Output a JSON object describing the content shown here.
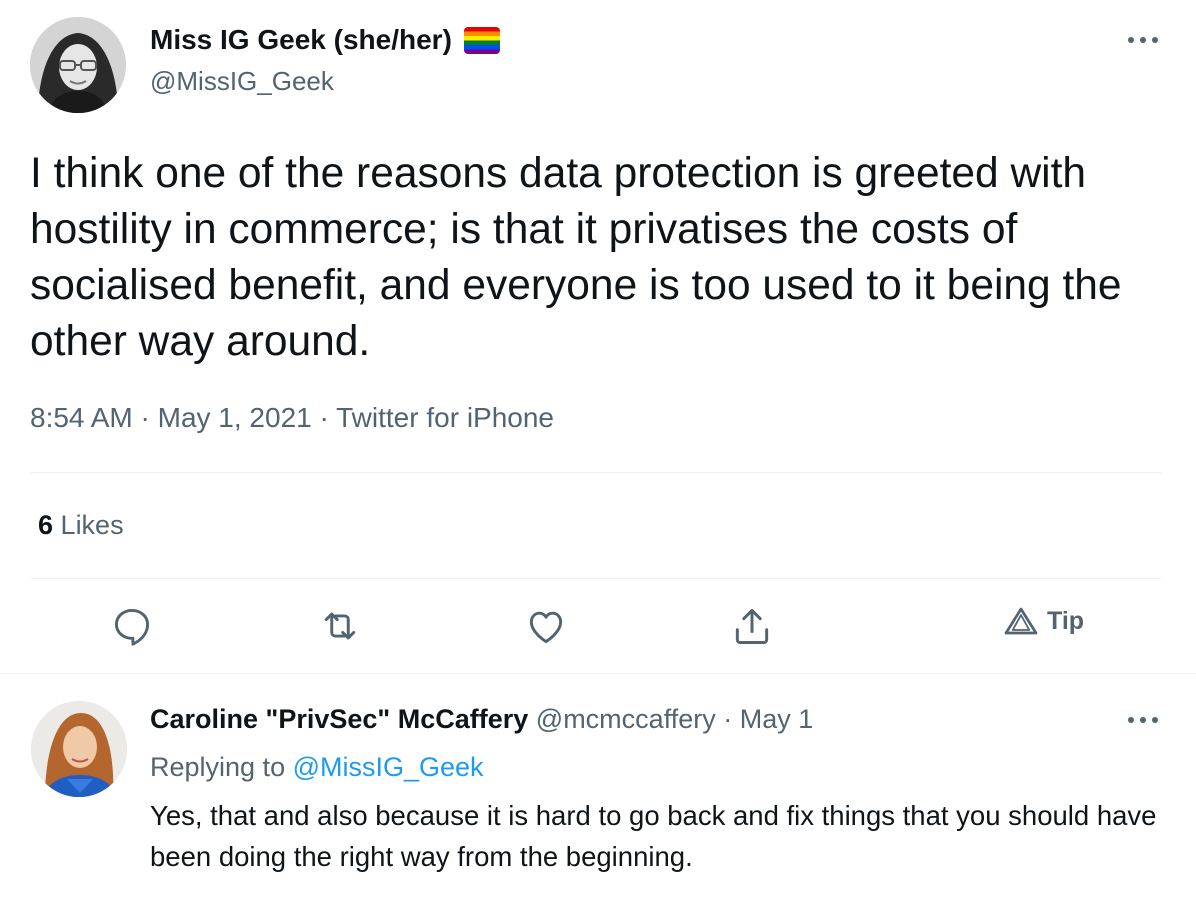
{
  "tweet": {
    "author_name": "Miss IG Geek (she/her)",
    "author_handle": "@MissIG_Geek",
    "text": "I think one of the reasons data protection is greeted with hostility in commerce; is that it privatises the costs of socialised benefit, and everyone is too used to it being the other way around.",
    "time": "8:54 AM",
    "date": "May 1, 2021",
    "source": "Twitter for iPhone",
    "separator": "·",
    "likes_count": "6",
    "likes_label": "Likes"
  },
  "actions": {
    "reply_icon": "reply-icon",
    "retweet_icon": "retweet-icon",
    "like_icon": "heart-icon",
    "share_icon": "share-icon",
    "tip_label": "Tip"
  },
  "reply": {
    "author_name": "Caroline \"PrivSec\" McCaffery",
    "author_handle": "@mcmccaffery",
    "separator": "·",
    "date": "May 1",
    "replying_prefix": "Replying to",
    "replying_to": "@MissIG_Geek",
    "text": "Yes, that and also because it is hard to go back and fix things that you should have been doing the right way from the beginning."
  },
  "colors": {
    "text_primary": "#0f1419",
    "text_secondary": "#536471",
    "link": "#1d9bf0",
    "divider": "#eff3f4"
  }
}
